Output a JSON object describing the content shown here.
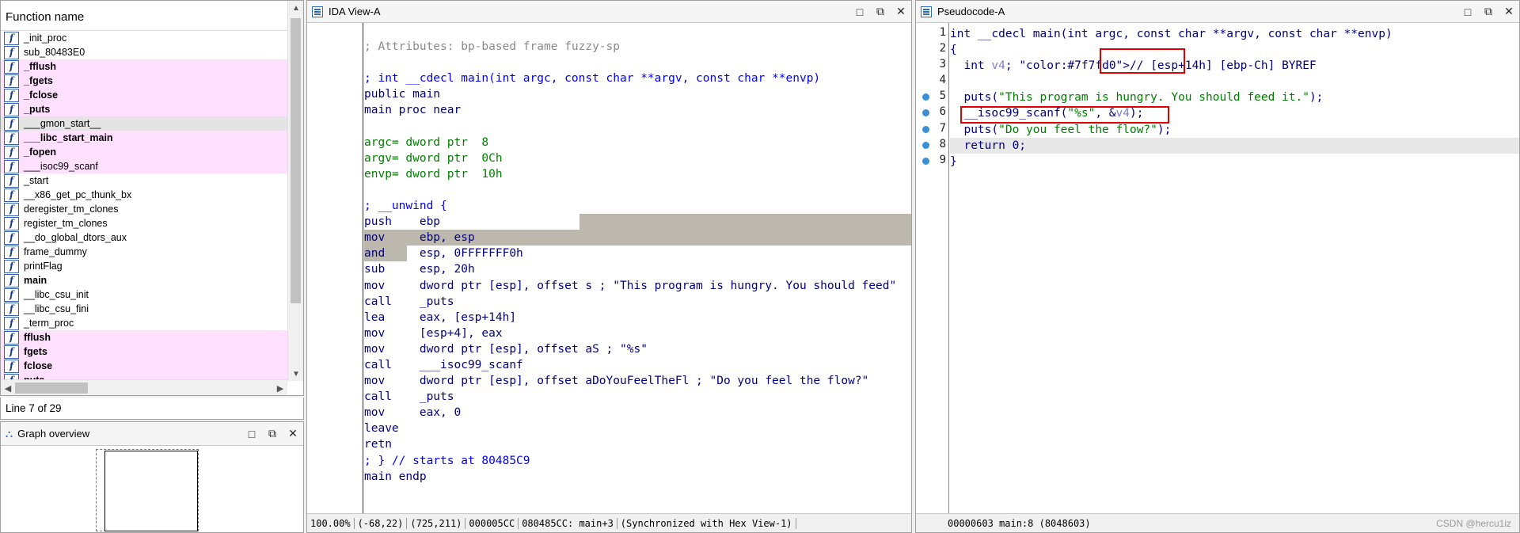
{
  "functions_panel": {
    "header": "Function name",
    "items": [
      {
        "name": "_init_proc",
        "style": "normal"
      },
      {
        "name": "sub_80483E0",
        "style": "normal"
      },
      {
        "name": "_fflush",
        "style": "lib"
      },
      {
        "name": "_fgets",
        "style": "lib"
      },
      {
        "name": "_fclose",
        "style": "lib"
      },
      {
        "name": "_puts",
        "style": "lib"
      },
      {
        "name": "___gmon_start__",
        "style": "selected"
      },
      {
        "name": "___libc_start_main",
        "style": "lib"
      },
      {
        "name": "_fopen",
        "style": "lib"
      },
      {
        "name": "___isoc99_scanf",
        "style": "libplain"
      },
      {
        "name": "_start",
        "style": "normal"
      },
      {
        "name": "__x86_get_pc_thunk_bx",
        "style": "normal"
      },
      {
        "name": "deregister_tm_clones",
        "style": "normal"
      },
      {
        "name": "register_tm_clones",
        "style": "normal"
      },
      {
        "name": "__do_global_dtors_aux",
        "style": "normal"
      },
      {
        "name": "frame_dummy",
        "style": "normal"
      },
      {
        "name": "printFlag",
        "style": "normal"
      },
      {
        "name": "main",
        "style": "bold"
      },
      {
        "name": "__libc_csu_init",
        "style": "normal"
      },
      {
        "name": "__libc_csu_fini",
        "style": "normal"
      },
      {
        "name": "_term_proc",
        "style": "normal"
      },
      {
        "name": "fflush",
        "style": "lib"
      },
      {
        "name": "fgets",
        "style": "lib"
      },
      {
        "name": "fclose",
        "style": "lib"
      },
      {
        "name": "puts",
        "style": "lib"
      }
    ],
    "status": "Line 7 of 29"
  },
  "graph_overview": {
    "title": "Graph overview"
  },
  "ida_view": {
    "title": "IDA View-A",
    "lines": [
      {
        "text": "",
        "cls": ""
      },
      {
        "text": "; Attributes: bp-based frame fuzzy-sp",
        "cls": "c-comment"
      },
      {
        "text": "",
        "cls": ""
      },
      {
        "text": "; int __cdecl main(int argc, const char **argv, const char **envp)",
        "cls": "c-blue"
      },
      {
        "text": "public main",
        "cls": "c-navy"
      },
      {
        "text": "main proc near",
        "cls": "c-navy"
      },
      {
        "text": "",
        "cls": ""
      },
      {
        "text": "argc= dword ptr  8",
        "cls": "c-green"
      },
      {
        "text": "argv= dword ptr  0Ch",
        "cls": "c-green"
      },
      {
        "text": "envp= dword ptr  10h",
        "cls": "c-green"
      },
      {
        "text": "",
        "cls": ""
      },
      {
        "text": "; __unwind {",
        "cls": "c-blue"
      },
      {
        "text": "push    ebp",
        "cls": "c-navy",
        "hl": "partial"
      },
      {
        "text": "mov     ebp, esp",
        "cls": "c-navy",
        "hl": "full"
      },
      {
        "text": "and     esp, 0FFFFFFF0h",
        "cls": "c-navy",
        "hl": "and"
      },
      {
        "text": "sub     esp, 20h",
        "cls": "c-navy"
      },
      {
        "text": "mov     dword ptr [esp], offset s ; \"This program is hungry. You should feed\"",
        "cls": "c-navy"
      },
      {
        "text": "call    _puts",
        "cls": "c-navy"
      },
      {
        "text": "lea     eax, [esp+14h]",
        "cls": "c-navy"
      },
      {
        "text": "mov     [esp+4], eax",
        "cls": "c-navy"
      },
      {
        "text": "mov     dword ptr [esp], offset aS ; \"%s\"",
        "cls": "c-navy"
      },
      {
        "text": "call    ___isoc99_scanf",
        "cls": "c-navy"
      },
      {
        "text": "mov     dword ptr [esp], offset aDoYouFeelTheFl ; \"Do you feel the flow?\"",
        "cls": "c-navy"
      },
      {
        "text": "call    _puts",
        "cls": "c-navy"
      },
      {
        "text": "mov     eax, 0",
        "cls": "c-navy"
      },
      {
        "text": "leave",
        "cls": "c-navy"
      },
      {
        "text": "retn",
        "cls": "c-navy"
      },
      {
        "text": "; } // starts at 80485C9",
        "cls": "c-blue"
      },
      {
        "text": "main endp",
        "cls": "c-navy"
      }
    ],
    "status": [
      "100.00%",
      "(-68,22)",
      "(725,211)",
      "000005CC",
      "080485CC: main+3",
      "(Synchronized with Hex View-1)"
    ]
  },
  "pseudocode": {
    "title": "Pseudocode-A",
    "lines": [
      {
        "num": "1",
        "text": "int __cdecl main(int argc, const char **argv, const char **envp)",
        "bp": false
      },
      {
        "num": "2",
        "text": "{",
        "bp": false
      },
      {
        "num": "3",
        "text": "  int v4; // [esp+14h] [ebp-Ch] BYREF",
        "bp": false
      },
      {
        "num": "4",
        "text": "",
        "bp": false
      },
      {
        "num": "5",
        "text": "  puts(\"This program is hungry. You should feed it.\");",
        "bp": true
      },
      {
        "num": "6",
        "text": "  __isoc99_scanf(\"%s\", &v4);",
        "bp": true
      },
      {
        "num": "7",
        "text": "  puts(\"Do you feel the flow?\");",
        "bp": true
      },
      {
        "num": "8",
        "text": "  return 0;",
        "bp": true
      },
      {
        "num": "9",
        "text": "}",
        "bp": true
      }
    ],
    "status": "00000603 main:8 (8048603)",
    "watermark": "CSDN @hercu1iz"
  },
  "window_controls": {
    "maximize": "□",
    "restore": "⧉",
    "close": "✕"
  }
}
